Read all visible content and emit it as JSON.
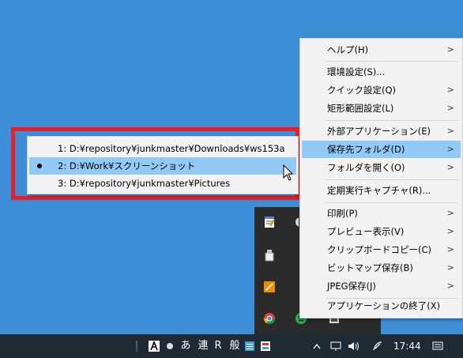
{
  "menu": {
    "items": [
      {
        "label": "ヘルプ(H)",
        "arrow": true
      },
      {
        "label": "環境設定(S)...",
        "arrow": false
      },
      {
        "label": "クイック設定(Q)",
        "arrow": true
      },
      {
        "label": "矩形範囲設定(L)",
        "arrow": true
      },
      {
        "label": "外部アプリケーション(E)",
        "arrow": true
      },
      {
        "label": "保存先フォルダ(D)",
        "arrow": true,
        "highlighted": true
      },
      {
        "label": "フォルダを開く(O)",
        "arrow": true
      },
      {
        "label": "定期実行キャプチャ(R)...",
        "arrow": false
      },
      {
        "label": "印刷(P)",
        "arrow": true
      },
      {
        "label": "プレビュー表示(V)",
        "arrow": true
      },
      {
        "label": "クリップボードコピー(C)",
        "arrow": true
      },
      {
        "label": "ビットマップ保存(B)",
        "arrow": true
      },
      {
        "label": "JPEG保存(J)",
        "arrow": true
      },
      {
        "label": "アプリケーションの終了(X)",
        "arrow": false
      }
    ]
  },
  "submenu": {
    "items": [
      {
        "label": "1: D:¥repository¥junkmaster¥Downloads¥ws153a",
        "selected": false
      },
      {
        "label": "2: D:¥Work¥スクリーンショット",
        "selected": true
      },
      {
        "label": "3: D:¥repository¥junkmaster¥Pictures",
        "selected": false
      }
    ]
  },
  "taskbar": {
    "ime": {
      "mode": "あ",
      "conv": "連",
      "r": "R",
      "general": "般"
    },
    "clock": "17:44",
    "colors": {
      "bg": "#1f2a35",
      "desktop": "#3d8ed7",
      "highlight": "#91c9f7",
      "annotation": "#ee1c24"
    }
  },
  "tray_icons": [
    "notepad-icon",
    "usb-drive-icon",
    "stamp-icon",
    "chrome-icon",
    "spotify-icon",
    "camera-icon"
  ]
}
